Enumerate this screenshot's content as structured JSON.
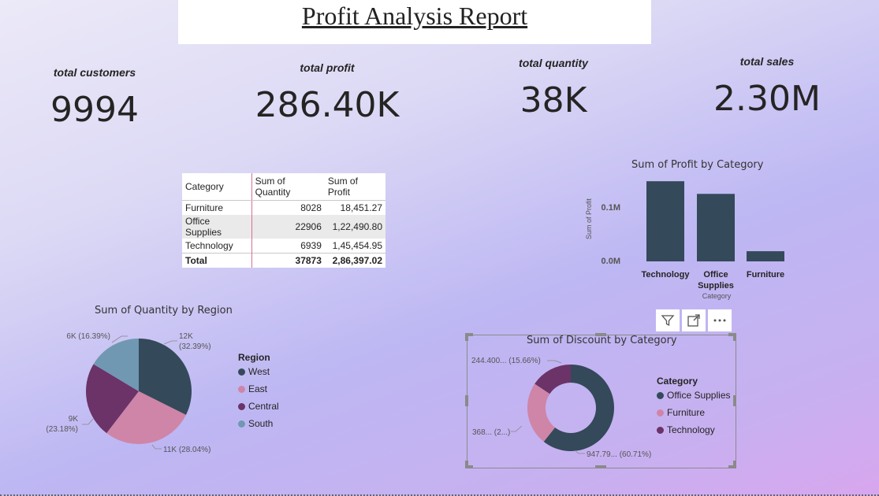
{
  "report": {
    "title": "Profit Analysis Report"
  },
  "kpis": [
    {
      "label": "total customers",
      "value": "9994"
    },
    {
      "label": "total profit",
      "value": "286.40K"
    },
    {
      "label": "total quantity",
      "value": "38K"
    },
    {
      "label": "total sales",
      "value": "2.30M"
    }
  ],
  "table": {
    "headers": [
      "Category",
      "Sum of Quantity",
      "Sum of Profit"
    ],
    "rows": [
      [
        "Furniture",
        "8028",
        "18,451.27"
      ],
      [
        "Office Supplies",
        "22906",
        "1,22,490.80"
      ],
      [
        "Technology",
        "6939",
        "1,45,454.95"
      ]
    ],
    "total": [
      "Total",
      "37873",
      "2,86,397.02"
    ]
  },
  "bar_chart": {
    "title": "Sum of Profit by Category",
    "ylabel": "Sum of Profit",
    "xlabel": "Category",
    "ticks": [
      "0.1M",
      "0.0M"
    ],
    "categories": [
      "Technology",
      "Office Supplies",
      "Furniture"
    ],
    "category_lines": [
      [
        "Technology"
      ],
      [
        "Office",
        "Supplies"
      ],
      [
        "Furniture"
      ]
    ],
    "bar_color": "#34495a"
  },
  "region_pie": {
    "title": "Sum of Quantity by Region",
    "legend_title": "Region",
    "labels": {
      "west_a": "12K",
      "west_b": "(32.39%)",
      "east": "11K (28.04%)",
      "central_a": "9K",
      "central_b": "(23.18%)",
      "south": "6K (16.39%)"
    },
    "legend": [
      {
        "name": "West",
        "color": "#34495a"
      },
      {
        "name": "East",
        "color": "#cf85a7"
      },
      {
        "name": "Central",
        "color": "#6b3367"
      },
      {
        "name": "South",
        "color": "#7098b3"
      }
    ]
  },
  "discount_donut": {
    "title": "Sum of Discount by Category",
    "legend_title": "Category",
    "labels": {
      "technology": "244.400... (15.66%)",
      "furniture": "368... (2...)",
      "office_supplies": "947.79... (60.71%)"
    },
    "legend": [
      {
        "name": "Office Supplies",
        "color": "#34495a"
      },
      {
        "name": "Furniture",
        "color": "#cf85a7"
      },
      {
        "name": "Technology",
        "color": "#6b3367"
      }
    ]
  },
  "chart_data": [
    {
      "type": "bar",
      "title": "Sum of Profit by Category",
      "categories": [
        "Technology",
        "Office Supplies",
        "Furniture"
      ],
      "values": [
        145454.95,
        122490.8,
        18451.27
      ],
      "xlabel": "Category",
      "ylabel": "Sum of Profit",
      "ylim": [
        0,
        150000
      ]
    },
    {
      "type": "pie",
      "title": "Sum of Quantity by Region",
      "categories": [
        "West",
        "East",
        "Central",
        "South"
      ],
      "values": [
        12266,
        10618,
        8780,
        6209
      ],
      "percentages": [
        32.39,
        28.04,
        23.18,
        16.39
      ]
    },
    {
      "type": "pie",
      "title": "Sum of Discount by Category",
      "categories": [
        "Office Supplies",
        "Furniture",
        "Technology"
      ],
      "percentages": [
        60.71,
        23.63,
        15.66
      ]
    }
  ]
}
